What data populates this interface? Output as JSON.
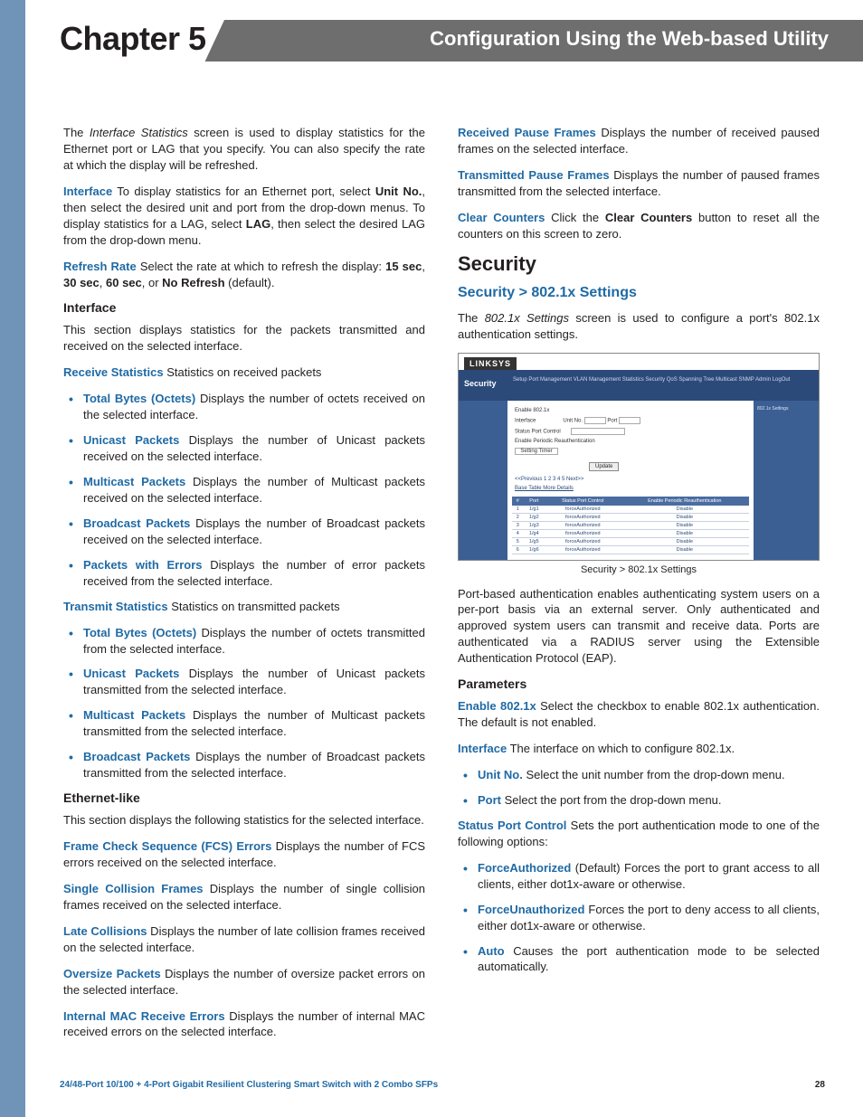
{
  "header": {
    "chapter": "Chapter 5",
    "utility_title": "Configuration Using the Web-based Utility"
  },
  "left": {
    "intro_pre": "The ",
    "intro_italic": "Interface Statistics",
    "intro_post": " screen is used to display statistics for the Ethernet port or LAG that you specify. You can also specify the rate at which the display will be refreshed.",
    "interface_label": "Interface",
    "interface_text_1": "  To display statistics for an Ethernet port, select ",
    "interface_bold_1": "Unit No.",
    "interface_text_2": ", then select the desired unit and port from the drop-down menus. To display statistics for a LAG, select ",
    "interface_bold_2": "LAG",
    "interface_text_3": ", then select the desired LAG from the drop-down menu.",
    "refresh_label": "Refresh Rate",
    "refresh_text_1": " Select the rate at which to refresh the display: ",
    "refresh_b1": "15 sec",
    "refresh_s1": ", ",
    "refresh_b2": "30 sec",
    "refresh_s2": ", ",
    "refresh_b3": "60 sec",
    "refresh_s3": ", or ",
    "refresh_b4": "No Refresh",
    "refresh_s4": " (default).",
    "interface_heading": "Interface",
    "interface_section_text": "This section displays statistics for the packets transmitted and received on the selected interface.",
    "receive_stats_label": "Receive Statistics",
    "receive_stats_text": "  Statistics on received packets",
    "rx": [
      {
        "label": "Total Bytes (Octets)",
        "text": "  Displays the number of octets received on the selected interface."
      },
      {
        "label": "Unicast Packets",
        "text": " Displays the number of Unicast packets received on the selected interface."
      },
      {
        "label": "Multicast Packets",
        "text": "  Displays the number of Multicast packets received on the selected interface."
      },
      {
        "label": "Broadcast Packets",
        "text": "  Displays the number of Broadcast packets received on the selected interface."
      },
      {
        "label": "Packets with Errors",
        "text": " Displays the number of error packets received from the selected interface."
      }
    ],
    "transmit_stats_label": "Transmit Statistics",
    "transmit_stats_text": "  Statistics on transmitted packets",
    "tx": [
      {
        "label": "Total Bytes (Octets)",
        "text": "  Displays the number of octets transmitted from the selected interface."
      },
      {
        "label": "Unicast Packets",
        "text": " Displays the number of Unicast packets transmitted from the selected interface."
      },
      {
        "label": "Multicast Packets",
        "text": "  Displays the number of Multicast packets transmitted from the selected interface."
      },
      {
        "label": "Broadcast Packets",
        "text": "  Displays the number of Broadcast packets transmitted from the selected interface."
      }
    ],
    "ethernet_heading": "Ethernet-like",
    "ethernet_text": "This section displays the following statistics for the selected interface.",
    "eth": [
      {
        "label": "Frame Check Sequence (FCS) Errors",
        "text": " Displays the number of FCS errors received on the selected interface."
      },
      {
        "label": "Single Collision Frames",
        "text": "  Displays the number of single collision frames received on the selected interface."
      },
      {
        "label": "Late Collisions",
        "text": " Displays the number of late collision frames received on the selected interface."
      },
      {
        "label": "Oversize Packets",
        "text": "   Displays the number of oversize packet errors on the selected interface."
      },
      {
        "label": "Internal MAC Receive Errors",
        "text": " Displays the number of internal MAC received errors on the selected interface."
      }
    ]
  },
  "right": {
    "top": [
      {
        "label": "Received Pause Frames",
        "text": "   Displays the number of received paused frames on the selected interface."
      },
      {
        "label": "Transmitted Pause Frames",
        "text": " Displays the number of paused frames transmitted from the selected interface."
      }
    ],
    "clear_label": "Clear Counters",
    "clear_text_1": "  Click the ",
    "clear_bold": "Clear Counters",
    "clear_text_2": " button to reset all the counters on this screen to zero.",
    "security_heading": "Security",
    "sec_sub_heading": "Security > 802.1x Settings",
    "sec_intro_pre": "The ",
    "sec_intro_italic": "802.1x Settings",
    "sec_intro_post": " screen is used to configure a port's 802.1x authentication settings.",
    "figure": {
      "logo": "LINKSYS",
      "tab_label": "Security",
      "tabs": "Setup   Port Management   VLAN Management   Statistics   Security   QoS   Spanning Tree   Multicast   SNMP   Admin   LogOut",
      "form": {
        "enable": "Enable 802.1x",
        "interface": "Interface",
        "status": "Status Port Control",
        "periodic": "Enable Periodic Reauthentication",
        "setting": "Setting Timer",
        "update_btn": "Update",
        "unit_label": "Unit No.",
        "port_label": "Port"
      },
      "table": {
        "pager": "<<Previous   1  2  3  4  5  Next>>",
        "links": "Base Table   More Details",
        "headers": [
          "#",
          "Port",
          "Status Port Control",
          "Enable Periodic Reauthentication"
        ],
        "rows": [
          {
            "n": "1",
            "port": "1/g1",
            "status": "forceAuthorized",
            "re": "Disable"
          },
          {
            "n": "2",
            "port": "1/g2",
            "status": "forceAuthorized",
            "re": "Disable"
          },
          {
            "n": "3",
            "port": "1/g3",
            "status": "forceAuthorized",
            "re": "Disable"
          },
          {
            "n": "4",
            "port": "1/g4",
            "status": "forceAuthorized",
            "re": "Disable"
          },
          {
            "n": "5",
            "port": "1/g5",
            "status": "forceAuthorized",
            "re": "Disable"
          },
          {
            "n": "6",
            "port": "1/g6",
            "status": "forceAuthorized",
            "re": "Disable"
          }
        ]
      },
      "help_title": "802.1x Settings",
      "caption": "Security > 802.1x Settings"
    },
    "port_auth_text": "Port-based authentication enables authenticating system users on a per-port basis via an external server. Only authenticated and approved system users can transmit and receive data. Ports are authenticated via a RADIUS server using the Extensible Authentication Protocol (EAP).",
    "params_heading": "Parameters",
    "enable_label": "Enable 802.1x",
    "enable_text": " Select the checkbox to enable 802.1x authentication. The default is not enabled.",
    "iface_label": "Interface",
    "iface_text": "   The interface on which to configure 802.1x.",
    "iface_items": [
      {
        "label": "Unit No.",
        "text": "  Select the unit number from the drop-down menu."
      },
      {
        "label": "Port",
        "text": "  Select the port from the drop-down menu."
      }
    ],
    "spc_label": "Status Port Control",
    "spc_text": "  Sets the port authentication mode to one of the following options:",
    "spc_items": [
      {
        "label": "ForceAuthorized",
        "text": " (Default) Forces the port to grant access to all clients, either dot1x-aware or otherwise."
      },
      {
        "label": "ForceUnauthorized",
        "text": " Forces the port to deny access to all clients, either dot1x-aware or otherwise."
      },
      {
        "label": "Auto",
        "text": " Causes the port authentication mode to be selected automatically."
      }
    ]
  },
  "footer": {
    "product": "24/48-Port 10/100 + 4-Port Gigabit Resilient Clustering Smart Switch with 2 Combo SFPs",
    "page": "28"
  }
}
